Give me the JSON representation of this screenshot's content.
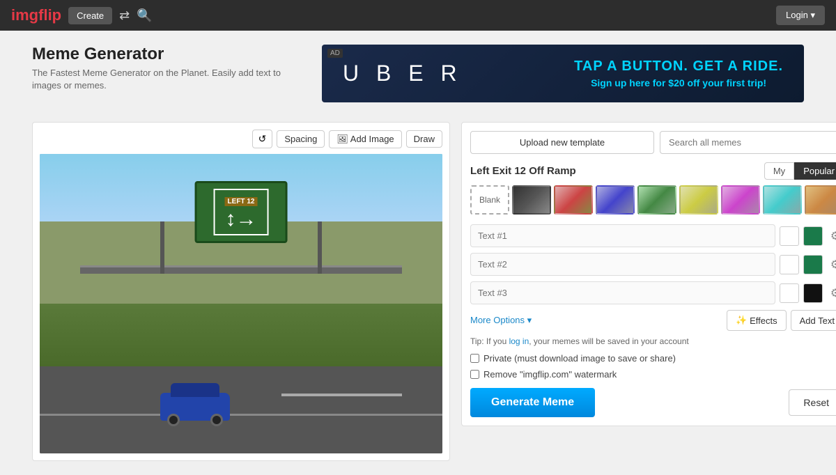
{
  "navbar": {
    "logo_img": "img",
    "logo_flip": "flip",
    "create_label": "Create",
    "login_label": "Login ▾"
  },
  "page": {
    "title": "Meme Generator",
    "subtitle": "The Fastest Meme Generator on the Planet. Easily\nadd text to images or memes."
  },
  "ad": {
    "label": "AD",
    "logo": "U B E R",
    "headline": "TAP A BUTTON. GET A RIDE.",
    "subtext_before": "Sign up here for ",
    "discount": "$20",
    "subtext_after": " off your first trip!"
  },
  "editor": {
    "refresh_icon": "↺",
    "spacing_label": "Spacing",
    "add_image_icon": "🖼",
    "add_image_label": "Add Image",
    "draw_label": "Draw"
  },
  "controls": {
    "upload_label": "Upload new template",
    "search_placeholder": "Search all memes",
    "template_title": "Left Exit 12 Off Ramp",
    "tab_my": "My",
    "tab_popular": "Popular",
    "blank_label": "Blank",
    "text1_placeholder": "Text #1",
    "text2_placeholder": "Text #2",
    "text3_placeholder": "Text #3",
    "more_options": "More Options ▾",
    "effects_label": "Effects",
    "add_text_label": "Add Text",
    "tip_prefix": "Tip: If you ",
    "tip_link": "log in",
    "tip_suffix": ", your memes will be saved in your account",
    "private_label": "Private (must download image to save or share)",
    "watermark_label": "Remove \"imgflip.com\" watermark",
    "generate_label": "Generate Meme",
    "reset_label": "Reset"
  }
}
